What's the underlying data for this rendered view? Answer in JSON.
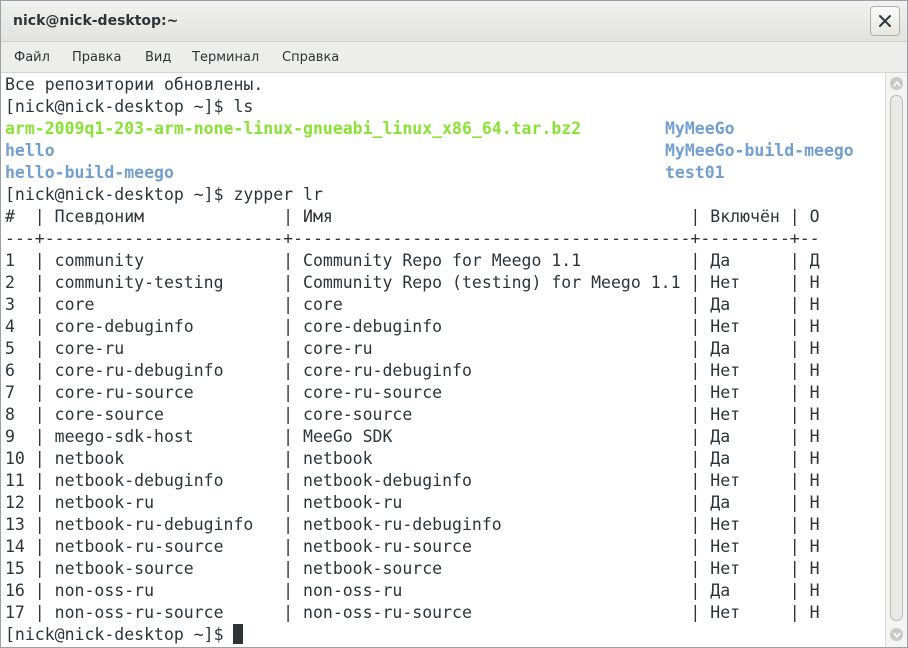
{
  "window": {
    "title": "nick@nick-desktop:~"
  },
  "icons": {
    "close": "close-icon",
    "scroll_up": "arrow-up-icon",
    "scroll_down": "arrow-down-icon"
  },
  "colors": {
    "archive_green": "#8ae234",
    "directory_blue": "#729fcf",
    "text": "#2e3436"
  },
  "menu": [
    "Файл",
    "Правка",
    "Вид",
    "Терминал",
    "Справка"
  ],
  "terminal": {
    "lines": [
      "Все репозитории обновлены.",
      "[nick@nick-desktop ~]$ ls",
      "",
      "",
      "",
      "[nick@nick-desktop ~]$ zypper lr",
      "#  | Псевдоним              | Имя                                    | Включён | О",
      "---+------------------------+----------------------------------------+---------+--",
      "1  | community              | Community Repo for Meego 1.1           | Да      | Д",
      "2  | community-testing      | Community Repo (testing) for Meego 1.1 | Нет     | Н",
      "3  | core                   | core                                   | Да      | Н",
      "4  | core-debuginfo         | core-debuginfo                         | Нет     | Н",
      "5  | core-ru                | core-ru                                | Да      | Н",
      "6  | core-ru-debuginfo      | core-ru-debuginfo                      | Нет     | Н",
      "7  | core-ru-source         | core-ru-source                         | Нет     | Н",
      "8  | core-source            | core-source                            | Нет     | Н",
      "9  | meego-sdk-host         | MeeGo SDK                              | Да      | Н",
      "10 | netbook                | netbook                                | Да      | Н",
      "11 | netbook-debuginfo      | netbook-debuginfo                      | Нет     | Н",
      "12 | netbook-ru             | netbook-ru                             | Да      | Н",
      "13 | netbook-ru-debuginfo   | netbook-ru-debuginfo                   | Нет     | Н",
      "14 | netbook-ru-source      | netbook-ru-source                      | Нет     | Н",
      "15 | netbook-source         | netbook-source                         | Нет     | Н",
      "16 | non-oss-ru             | non-oss-ru                             | Да      | Н",
      "17 | non-oss-ru-source      | non-oss-ru-source                      | Нет     | Н"
    ],
    "ls_output": {
      "archive": "arm-2009q1-203-arm-none-linux-gnueabi_linux_x86_64.tar.bz2",
      "dir_hello": "hello",
      "dir_hello_build": "hello-build-meego",
      "dir_mymeego": "MyMeeGo",
      "dir_mymeego_build": "MyMeeGo-build-meego",
      "dir_test01": "test01"
    },
    "prompt": "[nick@nick-desktop ~]$ "
  }
}
